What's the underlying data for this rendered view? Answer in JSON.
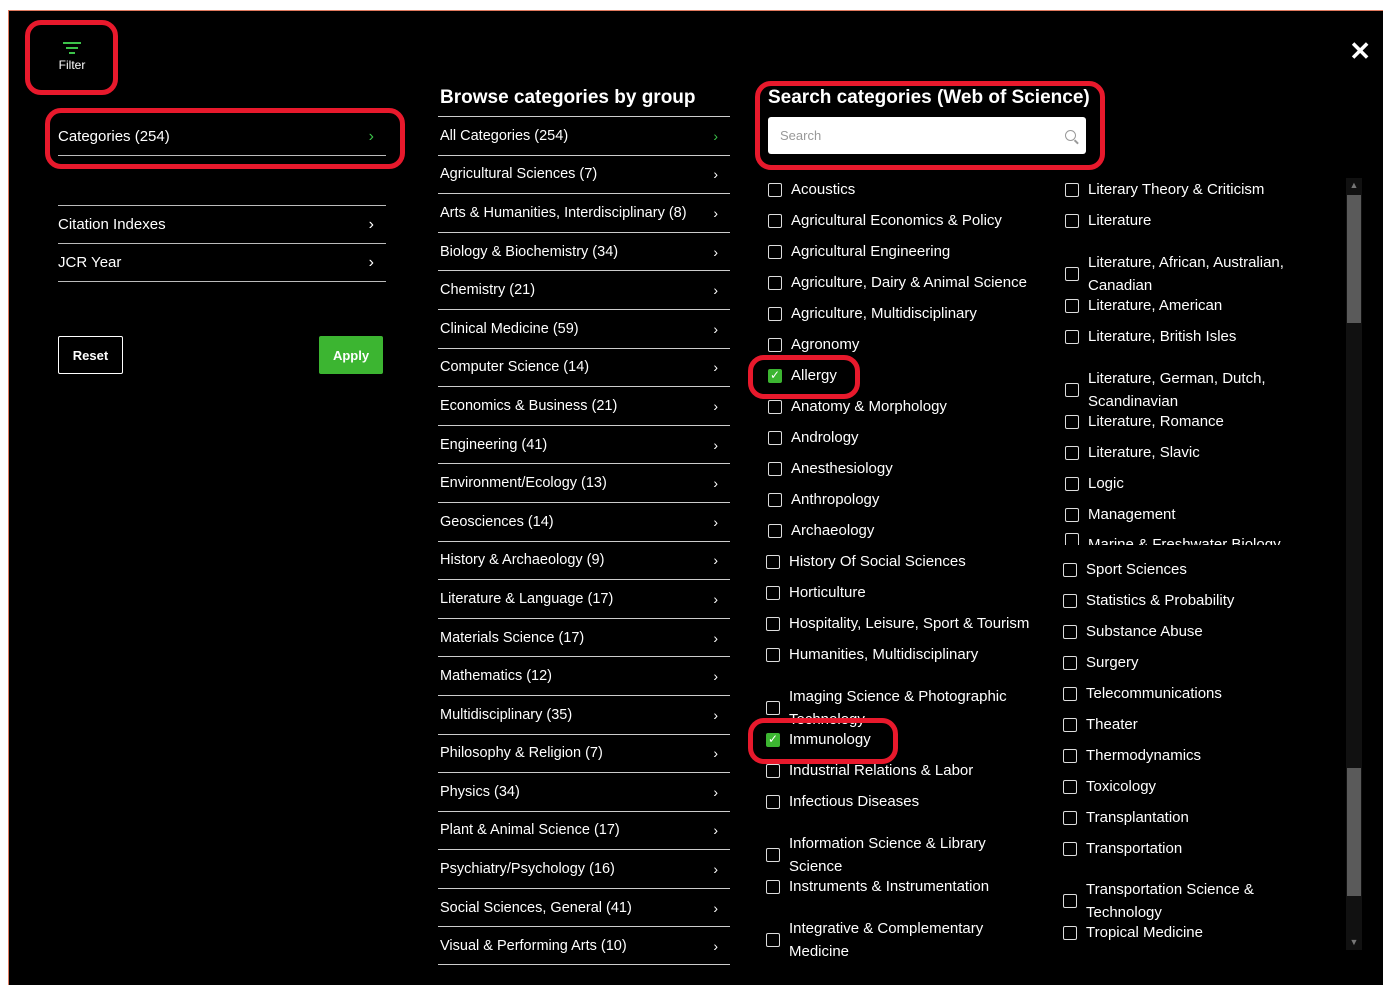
{
  "filter": {
    "label": "Filter"
  },
  "left_nav": {
    "categories": "Categories (254)",
    "citation_indexes": "Citation Indexes",
    "jcr_year": "JCR Year",
    "chevron": "›"
  },
  "buttons": {
    "reset": "Reset",
    "apply": "Apply"
  },
  "close_glyph": "✕",
  "groups": {
    "title": "Browse categories by group",
    "items": [
      "All Categories (254)",
      "Agricultural Sciences (7)",
      "Arts & Humanities, Interdisciplinary (8)",
      "Biology & Biochemistry (34)",
      "Chemistry (21)",
      "Clinical Medicine (59)",
      "Computer Science (14)",
      "Economics & Business (21)",
      "Engineering (41)",
      "Environment/Ecology (13)",
      "Geosciences (14)",
      "History & Archaeology (9)",
      "Literature & Language (17)",
      "Materials Science (17)",
      "Mathematics (12)",
      "Multidisciplinary (35)",
      "Philosophy & Religion (7)",
      "Physics (34)",
      "Plant & Animal Science (17)",
      "Psychiatry/Psychology (16)",
      "Social Sciences, General (41)",
      "Visual & Performing Arts (10)"
    ]
  },
  "search": {
    "title": "Search categories (Web of Science)",
    "placeholder": "Search"
  },
  "categories": {
    "col1_top": [
      "Acoustics",
      "Agricultural Economics & Policy",
      "Agricultural Engineering",
      "Agriculture, Dairy & Animal Science",
      "Agriculture, Multidisciplinary",
      "Agronomy",
      "Allergy",
      "Anatomy & Morphology",
      "Andrology",
      "Anesthesiology",
      "Anthropology",
      "Archaeology"
    ],
    "col1_bottom": [
      "History Of Social Sciences",
      "Horticulture",
      "Hospitality, Leisure, Sport & Tourism",
      "Humanities, Multidisciplinary",
      "Imaging Science & Photographic Technology",
      "Immunology",
      "Industrial Relations & Labor",
      "Infectious Diseases",
      "Information Science & Library Science",
      "Instruments & Instrumentation",
      "Integrative & Complementary Medicine"
    ],
    "col2_top": [
      "Literary Theory & Criticism",
      "Literature",
      "Literature, African, Australian, Canadian",
      "Literature, American",
      "Literature, British Isles",
      "Literature, German, Dutch, Scandinavian",
      "Literature, Romance",
      "Literature, Slavic",
      "Logic",
      "Management",
      "Marine & Freshwater Biology"
    ],
    "col2_bottom": [
      "Sport Sciences",
      "Statistics & Probability",
      "Substance Abuse",
      "Surgery",
      "Telecommunications",
      "Theater",
      "Thermodynamics",
      "Toxicology",
      "Transplantation",
      "Transportation",
      "Transportation Science & Technology",
      "Tropical Medicine"
    ],
    "checked": [
      "Allergy",
      "Immunology"
    ]
  }
}
